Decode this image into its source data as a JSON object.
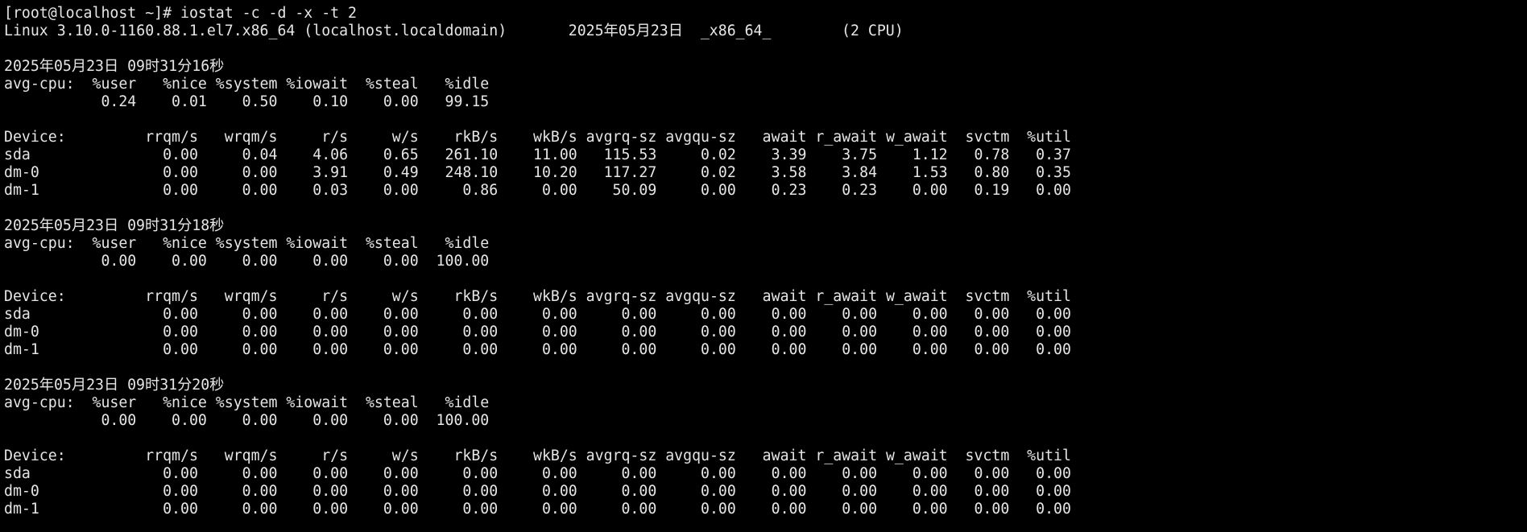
{
  "terminal": {
    "colors": {
      "background": "#000000",
      "foreground": "#e6e6e6"
    },
    "lines": [
      "[root@localhost ~]# iostat -c -d -x -t 2",
      "Linux 3.10.0-1160.88.1.el7.x86_64 (localhost.localdomain)       2025年05月23日  _x86_64_        (2 CPU)",
      "",
      "2025年05月23日 09时31分16秒",
      "avg-cpu:  %user   %nice %system %iowait  %steal   %idle",
      "           0.24    0.01    0.50    0.10    0.00   99.15",
      "",
      "Device:         rrqm/s   wrqm/s     r/s     w/s    rkB/s    wkB/s avgrq-sz avgqu-sz   await r_await w_await  svctm  %util",
      "sda               0.00     0.04    4.06    0.65   261.10    11.00   115.53     0.02    3.39    3.75    1.12   0.78   0.37",
      "dm-0              0.00     0.00    3.91    0.49   248.10    10.20   117.27     0.02    3.58    3.84    1.53   0.80   0.35",
      "dm-1              0.00     0.00    0.03    0.00     0.86     0.00    50.09     0.00    0.23    0.23    0.00   0.19   0.00",
      "",
      "2025年05月23日 09时31分18秒",
      "avg-cpu:  %user   %nice %system %iowait  %steal   %idle",
      "           0.00    0.00    0.00    0.00    0.00  100.00",
      "",
      "Device:         rrqm/s   wrqm/s     r/s     w/s    rkB/s    wkB/s avgrq-sz avgqu-sz   await r_await w_await  svctm  %util",
      "sda               0.00     0.00    0.00    0.00     0.00     0.00     0.00     0.00    0.00    0.00    0.00   0.00   0.00",
      "dm-0              0.00     0.00    0.00    0.00     0.00     0.00     0.00     0.00    0.00    0.00    0.00   0.00   0.00",
      "dm-1              0.00     0.00    0.00    0.00     0.00     0.00     0.00     0.00    0.00    0.00    0.00   0.00   0.00",
      "",
      "2025年05月23日 09时31分20秒",
      "avg-cpu:  %user   %nice %system %iowait  %steal   %idle",
      "           0.00    0.00    0.00    0.00    0.00  100.00",
      "",
      "Device:         rrqm/s   wrqm/s     r/s     w/s    rkB/s    wkB/s avgrq-sz avgqu-sz   await r_await w_await  svctm  %util",
      "sda               0.00     0.00    0.00    0.00     0.00     0.00     0.00     0.00    0.00    0.00    0.00   0.00   0.00",
      "dm-0              0.00     0.00    0.00    0.00     0.00     0.00     0.00     0.00    0.00    0.00    0.00   0.00   0.00",
      "dm-1              0.00     0.00    0.00    0.00     0.00     0.00     0.00     0.00    0.00    0.00    0.00   0.00   0.00"
    ]
  }
}
